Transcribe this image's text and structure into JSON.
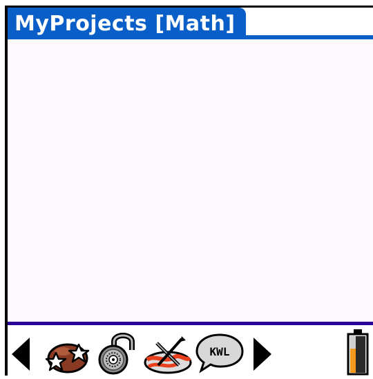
{
  "window": {
    "title": "MyProjects [Math]"
  },
  "colors": {
    "title_bar": "#0a5ec7",
    "divider": "#2a0097",
    "content_bg": "#fdf9ff"
  },
  "toolbar": {
    "items": [
      {
        "name": "prev-arrow-icon"
      },
      {
        "name": "stars-icon"
      },
      {
        "name": "lock-icon"
      },
      {
        "name": "tools-icon"
      },
      {
        "name": "kwl-icon",
        "label": "KWL"
      },
      {
        "name": "next-arrow-icon"
      },
      {
        "name": "battery-icon"
      }
    ]
  }
}
